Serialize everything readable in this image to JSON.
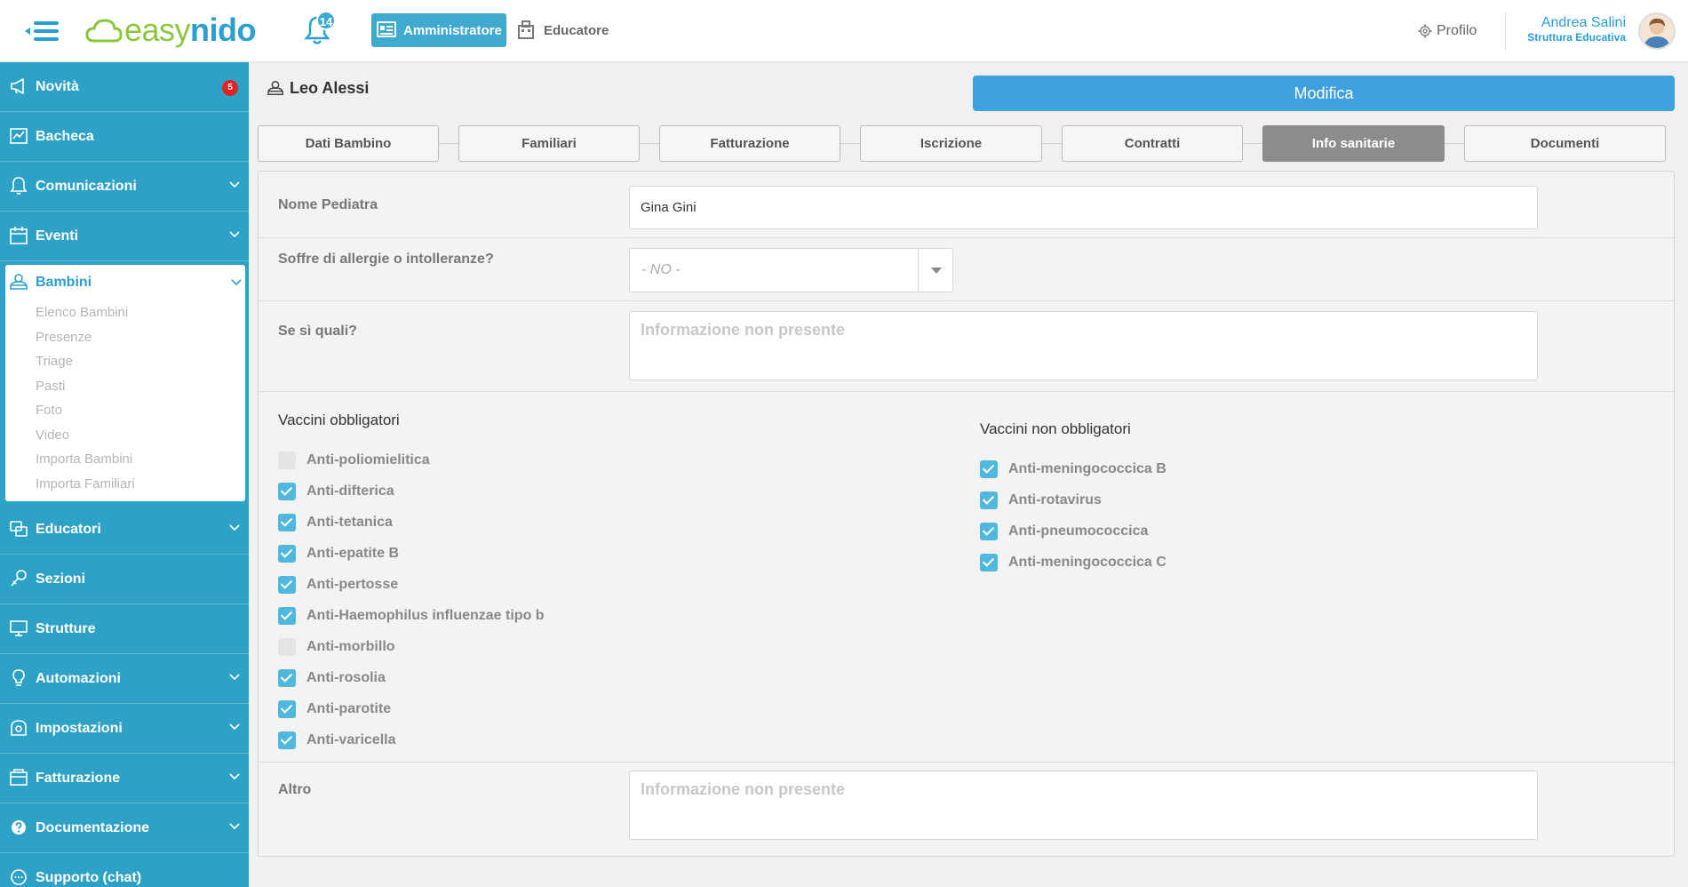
{
  "app": {
    "logo_part1": "easy",
    "logo_part2": "nido",
    "notifications_count": "14",
    "role_admin_label": "Amministratore",
    "role_educator_label": "Educatore",
    "profile_label": "Profilo",
    "user_name": "Andrea Salini",
    "user_role": "Struttura Educativa",
    "accent_color": "#2ea2c6"
  },
  "sidebar": {
    "items_top": [
      {
        "label": "Novità",
        "icon": "megaphone-icon",
        "badge": "5"
      },
      {
        "label": "Bacheca",
        "icon": "board-icon"
      },
      {
        "label": "Comunicazioni",
        "icon": "bell-icon"
      },
      {
        "label": "Eventi",
        "icon": "calendar-icon"
      }
    ],
    "active": {
      "label": "Bambini",
      "icon": "child-icon",
      "subitems": [
        "Elenco Bambini",
        "Presenze",
        "Triage",
        "Pasti",
        "Foto",
        "Video",
        "Importa Bambini",
        "Importa Familiari"
      ]
    },
    "items_bottom": [
      {
        "label": "Educatori",
        "icon": "educator-icon"
      },
      {
        "label": "Sezioni",
        "icon": "section-icon"
      },
      {
        "label": "Strutture",
        "icon": "monitor-icon"
      },
      {
        "label": "Automazioni",
        "icon": "bulb-icon"
      },
      {
        "label": "Impostazioni",
        "icon": "settings-icon"
      },
      {
        "label": "Fatturazione",
        "icon": "invoice-icon"
      },
      {
        "label": "Documentazione",
        "icon": "help-icon"
      },
      {
        "label": "Supporto (chat)",
        "icon": "chat-icon"
      }
    ]
  },
  "child": {
    "name": "Leo Alessi"
  },
  "actions": {
    "edit_label": "Modifica"
  },
  "tabs": [
    "Dati Bambino",
    "Familiari",
    "Fatturazione",
    "Iscrizione",
    "Contratti",
    "Info sanitarie",
    "Documenti"
  ],
  "active_tab": "Info sanitarie",
  "form": {
    "pediatrician_label": "Nome Pediatra",
    "pediatrician_value": "Gina Gini",
    "allergies_label": "Soffre di allergie o intolleranze?",
    "allergies_value": "- NO -",
    "which_label": "Se sì quali?",
    "which_placeholder": "Informazione non presente",
    "other_label": "Altro",
    "other_placeholder": "Informazione non presente"
  },
  "vaccines": {
    "mandatory_title": "Vaccini obbligatori",
    "mandatory": [
      {
        "label": "Anti-poliomielitica",
        "checked": false
      },
      {
        "label": "Anti-difterica",
        "checked": true
      },
      {
        "label": "Anti-tetanica",
        "checked": true
      },
      {
        "label": "Anti-epatite B",
        "checked": true
      },
      {
        "label": "Anti-pertosse",
        "checked": true
      },
      {
        "label": "Anti-Haemophilus influenzae tipo b",
        "checked": true
      },
      {
        "label": "Anti-morbillo",
        "checked": false
      },
      {
        "label": "Anti-rosolia",
        "checked": true
      },
      {
        "label": "Anti-parotite",
        "checked": true
      },
      {
        "label": "Anti-varicella",
        "checked": true
      }
    ],
    "optional_title": "Vaccini non obbligatori",
    "optional": [
      {
        "label": "Anti-meningococcica B",
        "checked": true
      },
      {
        "label": "Anti-rotavirus",
        "checked": true
      },
      {
        "label": "Anti-pneumococcica",
        "checked": true
      },
      {
        "label": "Anti-meningococcica C",
        "checked": true
      }
    ]
  }
}
